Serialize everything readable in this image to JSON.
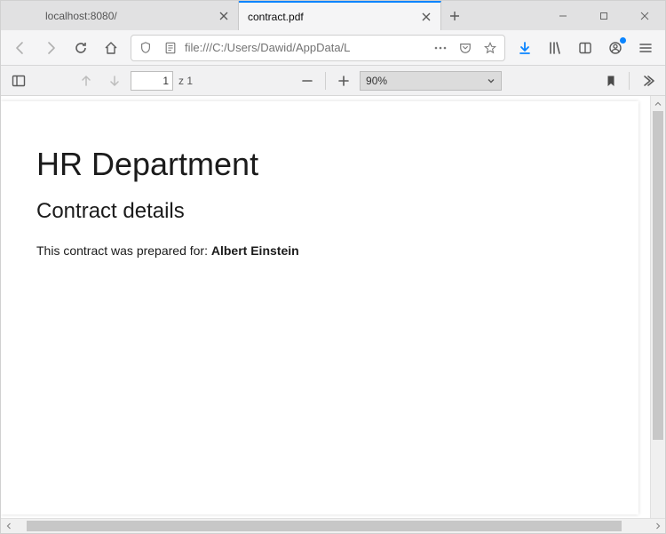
{
  "tabs": [
    {
      "label": "localhost:8080/"
    },
    {
      "label": "contract.pdf"
    }
  ],
  "url": "file:///C:/Users/Dawid/AppData/L",
  "pdf": {
    "page_current": "1",
    "page_sep": "z",
    "page_total": "1",
    "zoom": "90%"
  },
  "document": {
    "h1": "HR Department",
    "h2": "Contract details",
    "line_prefix": "This contract was prepared for: ",
    "line_bold": "Albert Einstein"
  }
}
